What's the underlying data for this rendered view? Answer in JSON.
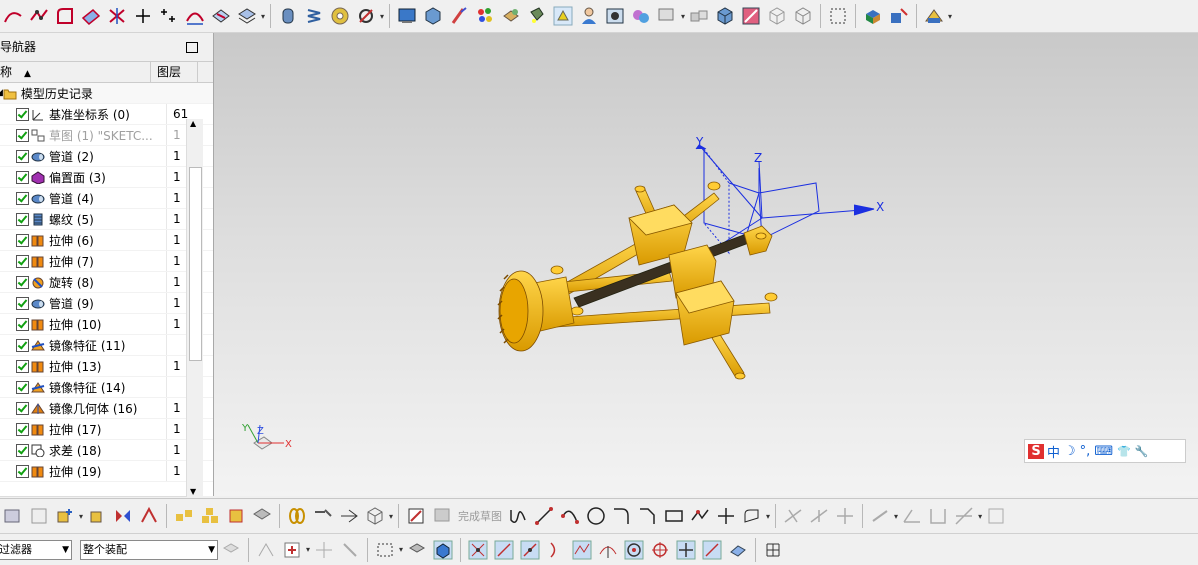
{
  "navigator": {
    "title": "部件导航器",
    "col_name": "名称",
    "col_layer": "图层",
    "root": "模型历史记录",
    "rows": [
      {
        "label": "基准坐标系 (0)",
        "layer": "61",
        "icon": "datum-csys-icon",
        "dim": false
      },
      {
        "label": "草图 (1) \"SKETC...",
        "layer": "1",
        "icon": "sketch-icon",
        "dim": true
      },
      {
        "label": "管道 (2)",
        "layer": "1",
        "icon": "tube-icon",
        "dim": false
      },
      {
        "label": "偏置面 (3)",
        "layer": "1",
        "icon": "offset-face-icon",
        "dim": false
      },
      {
        "label": "管道 (4)",
        "layer": "1",
        "icon": "tube-icon",
        "dim": false
      },
      {
        "label": "螺纹 (5)",
        "layer": "1",
        "icon": "thread-icon",
        "dim": false
      },
      {
        "label": "拉伸 (6)",
        "layer": "1",
        "icon": "extrude-icon",
        "dim": false
      },
      {
        "label": "拉伸 (7)",
        "layer": "1",
        "icon": "extrude-icon",
        "dim": false
      },
      {
        "label": "旋转 (8)",
        "layer": "1",
        "icon": "revolve-icon",
        "dim": false
      },
      {
        "label": "管道 (9)",
        "layer": "1",
        "icon": "tube-icon",
        "dim": false
      },
      {
        "label": "拉伸 (10)",
        "layer": "1",
        "icon": "extrude-icon",
        "dim": false
      },
      {
        "label": "镜像特征 (11)",
        "layer": "",
        "icon": "mirror-feature-icon",
        "dim": false
      },
      {
        "label": "拉伸 (13)",
        "layer": "1",
        "icon": "extrude-icon",
        "dim": false
      },
      {
        "label": "镜像特征 (14)",
        "layer": "",
        "icon": "mirror-feature-icon",
        "dim": false
      },
      {
        "label": "镜像几何体 (16)",
        "layer": "1",
        "icon": "mirror-body-icon",
        "dim": false
      },
      {
        "label": "拉伸 (17)",
        "layer": "1",
        "icon": "extrude-icon",
        "dim": false
      },
      {
        "label": "求差 (18)",
        "layer": "1",
        "icon": "subtract-icon",
        "dim": false
      },
      {
        "label": "拉伸 (19)",
        "layer": "1",
        "icon": "extrude-icon",
        "dim": false
      }
    ]
  },
  "viewport": {
    "axis_x": "X",
    "axis_y": "Y",
    "axis_z": "Z",
    "triad_x": "X",
    "triad_y": "Y",
    "triad_z": "Z"
  },
  "ime": {
    "s_icon": "S",
    "mode": "中",
    "moon": "☽",
    "punct": "°,",
    "keyboard": "⌨",
    "shirt": "👕",
    "wrench": "🔧"
  },
  "bottom": {
    "finish_sketch": "完成草图",
    "filter_combo": "没有选择过滤器",
    "assembly_combo": "整个装配"
  },
  "colors": {
    "model_yellow": "#f5b400",
    "model_dark": "#c88700",
    "csys_blue": "#1b2fe0",
    "check_green": "#10a010"
  }
}
